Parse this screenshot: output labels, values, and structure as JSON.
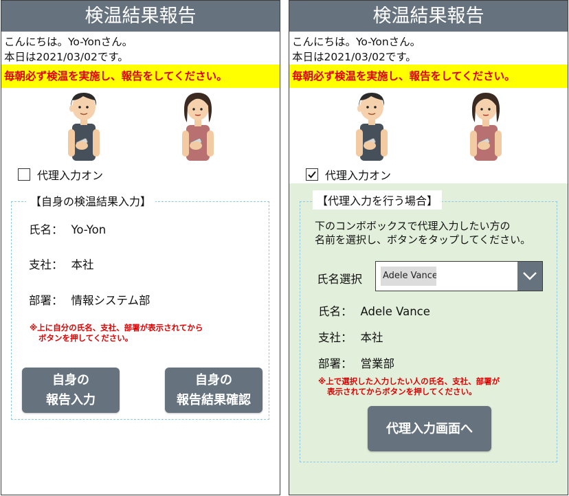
{
  "left": {
    "title": "検温結果報告",
    "greeting": "こんにちは。Yo-Yonさん。",
    "date_line": "本日は2021/03/02です。",
    "banner": "毎朝必ず検温を実施し、報告をしてください。",
    "proxy_toggle": {
      "label": "代理入力オン",
      "checked": false
    },
    "panel_title": "【自身の検温結果入力】",
    "fields": [
      {
        "label": "氏名：",
        "value": "Yo-Yon"
      },
      {
        "label": "支社：",
        "value": "本社"
      },
      {
        "label": "部署：",
        "value": "情報システム部"
      }
    ],
    "note": [
      "※上に自分の氏名、支社、部署が表示されてから",
      "ボタンを押してください。"
    ],
    "buttons": {
      "report_input": [
        "自身の",
        "報告入力"
      ],
      "result_check": [
        "自身の",
        "報告結果確認"
      ]
    }
  },
  "right": {
    "title": "検温結果報告",
    "greeting": "こんにちは。Yo-Yonさん。",
    "date_line": "本日は2021/03/02です。",
    "banner": "毎朝必ず検温を実施し、報告をしてください。",
    "proxy_toggle": {
      "label": "代理入力オン",
      "checked": true
    },
    "panel_title": "【代理入力を行う場合】",
    "description": [
      "下のコンボボックスで代理入力したい方の",
      "名前を選択し、ボタンをタップしてください。"
    ],
    "name_select": {
      "label": "氏名選択",
      "selected": "Adele Vance"
    },
    "fields": [
      {
        "label": "氏名：",
        "value": "Adele Vance"
      },
      {
        "label": "支社：",
        "value": "本社"
      },
      {
        "label": "部署：",
        "value": "営業部"
      }
    ],
    "note": [
      "※上で選択した入力したい人の氏名、支社、部署が",
      "表示されてからボタンを押してください。"
    ],
    "button": "代理入力画面へ"
  },
  "colors": {
    "header": "#66737f",
    "banner_bg": "#ffff00",
    "banner_text": "#e00000",
    "proxy_panel_bg": "#e2efda",
    "panel_border": "#8ecae6"
  },
  "icons": [
    "man-thermometer-illustration",
    "woman-thermometer-illustration",
    "checkbox-icon",
    "checkmark-icon",
    "chevron-down-icon"
  ]
}
